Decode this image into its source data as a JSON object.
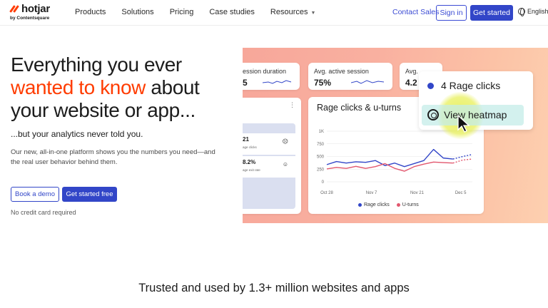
{
  "brand": {
    "name": "hotjar",
    "byline": "by Contentsquare",
    "accent": "#ff3c00",
    "primary": "#3246c8"
  },
  "nav": {
    "items": [
      {
        "label": "Products"
      },
      {
        "label": "Solutions"
      },
      {
        "label": "Pricing"
      },
      {
        "label": "Case studies"
      },
      {
        "label": "Resources"
      }
    ],
    "contact": "Contact Sales",
    "signin": "Sign in",
    "get_started": "Get started",
    "language": "English",
    "icons": {
      "language": "globe-icon",
      "resources": "chevron-down-icon"
    }
  },
  "hero": {
    "line1": "Everything you ever",
    "line2_accent": "wanted to know",
    "line2_rest": " about",
    "line3": "your website or app...",
    "subheading": "...but your analytics never told you.",
    "description": "Our new, all-in-one platform shows you the numbers you need—and the real user behavior behind them.",
    "demo_button": "Book a demo",
    "free_button": "Get started free",
    "note": "No credit card required"
  },
  "dashboard": {
    "stats": [
      {
        "label": "ession duration",
        "value": "5"
      },
      {
        "label": "Avg. active session",
        "value": "75%"
      },
      {
        "label": "Avg. ",
        "value": "4.2"
      }
    ],
    "side_card": {
      "items": [
        {
          "value": "21",
          "sub": "age clicks"
        },
        {
          "value": "8.2%",
          "sub": "age exit rate"
        }
      ]
    },
    "chart_title": "Rage clicks & u-turns",
    "popup": {
      "rage": "4 Rage clicks",
      "heatmap": "View heatmap"
    }
  },
  "chart_data": {
    "type": "line",
    "title": "Rage clicks & u-turns",
    "x": [
      "Oct 28",
      "Nov 7",
      "Nov 21",
      "Dec 5"
    ],
    "ytick_labels": [
      "1K",
      "750",
      "500",
      "250",
      "0"
    ],
    "ylim": [
      0,
      1000
    ],
    "grid": true,
    "legend_position": "bottom",
    "series": [
      {
        "name": "Rage clicks",
        "color": "#3246c8",
        "points": [
          [
            0,
            340
          ],
          [
            1,
            400
          ],
          [
            2,
            370
          ],
          [
            3,
            395
          ],
          [
            4,
            385
          ],
          [
            5,
            420
          ],
          [
            6,
            320
          ],
          [
            7,
            370
          ],
          [
            8,
            300
          ],
          [
            9,
            360
          ],
          [
            10,
            420
          ],
          [
            11,
            640
          ],
          [
            12,
            470
          ],
          [
            13,
            450
          ],
          [
            14,
            500
          ],
          [
            15,
            540
          ]
        ]
      },
      {
        "name": "U-turns",
        "color": "#e2576e",
        "points": [
          [
            0,
            255
          ],
          [
            1,
            285
          ],
          [
            2,
            265
          ],
          [
            3,
            305
          ],
          [
            4,
            265
          ],
          [
            5,
            300
          ],
          [
            6,
            360
          ],
          [
            7,
            265
          ],
          [
            8,
            210
          ],
          [
            9,
            300
          ],
          [
            10,
            350
          ],
          [
            11,
            390
          ],
          [
            12,
            380
          ],
          [
            13,
            370
          ],
          [
            14,
            430
          ],
          [
            15,
            450
          ]
        ]
      }
    ]
  },
  "trusted": "Trusted and used by 1.3+ million websites and apps"
}
